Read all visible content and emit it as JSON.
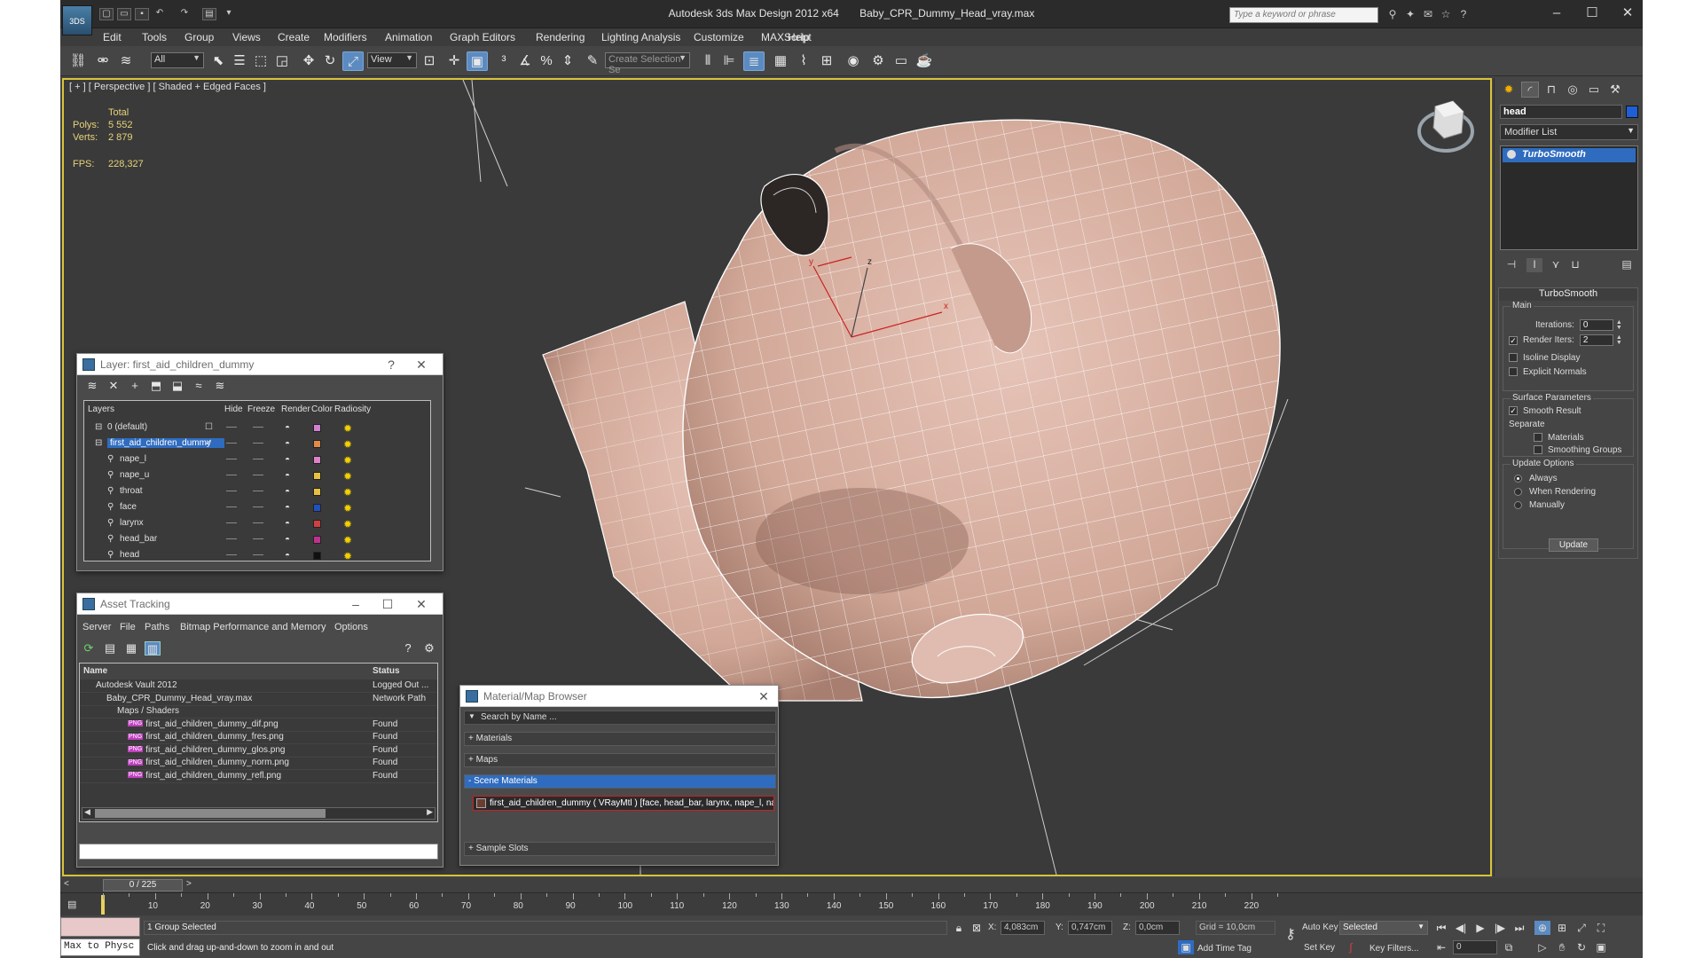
{
  "app": {
    "logo_text": "3DS",
    "title": "Autodesk 3ds Max Design 2012 x64       Baby_CPR_Dummy_Head_vray.max",
    "search_placeholder": "Type a keyword or phrase"
  },
  "menu": [
    "Edit",
    "Tools",
    "Group",
    "Views",
    "Create",
    "Modifiers",
    "Animation",
    "Graph Editors",
    "Rendering",
    "Lighting Analysis",
    "Customize",
    "MAXScript",
    "Help"
  ],
  "toolbar": {
    "filter_value": "All",
    "ref_coord_value": "View",
    "selection_set_placeholder": "Create Selection Se"
  },
  "viewport": {
    "label": "[ + ] [ Perspective ] [ Shaded + Edged Faces ]",
    "stats_total": "Total",
    "polys_label": "Polys:",
    "polys_value": "5 552",
    "verts_label": "Verts:",
    "verts_value": "2 879",
    "fps_label": "FPS:",
    "fps_value": "228,327",
    "axis_x": "x",
    "axis_y": "y",
    "axis_z": "z",
    "mesh_color": "#d8b0a4",
    "wire_color": "#ffffff",
    "frame_color": "#d8c43a"
  },
  "command_panel": {
    "object_name": "head",
    "object_color": "#1e5fd6",
    "modifier_list_label": "Modifier List",
    "stack_item": "TurboSmooth",
    "rollout_title": "TurboSmooth",
    "main_label": "Main",
    "iterations_label": "Iterations:",
    "iterations_value": "0",
    "render_iters_label": "Render Iters:",
    "render_iters_value": "2",
    "render_iters_checked": true,
    "isoline_label": "Isoline Display",
    "explicit_normals_label": "Explicit Normals",
    "surface_params_label": "Surface Parameters",
    "smooth_result_label": "Smooth Result",
    "separate_label": "Separate",
    "materials_label": "Materials",
    "smoothing_groups_label": "Smoothing Groups",
    "update_options_label": "Update Options",
    "always_label": "Always",
    "when_rendering_label": "When Rendering",
    "manually_label": "Manually",
    "update_button": "Update"
  },
  "layer_panel": {
    "title": "Layer: first_aid_children_dummy",
    "help": "?",
    "headers": {
      "layers": "Layers",
      "hide": "Hide",
      "freeze": "Freeze",
      "render": "Render",
      "color": "Color",
      "radiosity": "Radiosity"
    },
    "rows": [
      {
        "name": "0 (default)",
        "color": "#d080d0"
      },
      {
        "name": "first_aid_children_dummy",
        "color": "#e08a4a"
      },
      {
        "name": "nape_l",
        "color": "#e080c8"
      },
      {
        "name": "nape_u",
        "color": "#e8c040"
      },
      {
        "name": "throat",
        "color": "#e8c040"
      },
      {
        "name": "face",
        "color": "#2050c0"
      },
      {
        "name": "larynx",
        "color": "#d04040"
      },
      {
        "name": "head_bar",
        "color": "#c03090"
      },
      {
        "name": "head",
        "color": "#101010"
      }
    ]
  },
  "asset_panel": {
    "title": "Asset Tracking",
    "menu": [
      "Server",
      "File",
      "Paths",
      "Bitmap Performance and Memory",
      "Options"
    ],
    "col_name": "Name",
    "col_status": "Status",
    "png_tag": "PNG",
    "rows": [
      {
        "name": "Autodesk Vault 2012",
        "status": "Logged Out ..."
      },
      {
        "name": "Baby_CPR_Dummy_Head_vray.max",
        "status": "Network Path"
      },
      {
        "name": "Maps / Shaders",
        "status": ""
      },
      {
        "name": "first_aid_children_dummy_dif.png",
        "status": "Found"
      },
      {
        "name": "first_aid_children_dummy_fres.png",
        "status": "Found"
      },
      {
        "name": "first_aid_children_dummy_glos.png",
        "status": "Found"
      },
      {
        "name": "first_aid_children_dummy_norm.png",
        "status": "Found"
      },
      {
        "name": "first_aid_children_dummy_refl.png",
        "status": "Found"
      }
    ]
  },
  "material_browser": {
    "title": "Material/Map Browser",
    "search_placeholder": "Search by Name ...",
    "sec_materials": "+ Materials",
    "sec_maps": "+ Maps",
    "sec_scene": "- Scene Materials",
    "scene_material": "first_aid_children_dummy  ( VRayMtl )  [face, head_bar, larynx, nape_l, nape_u,...",
    "sec_samples": "+ Sample Slots"
  },
  "timeline": {
    "frame": "0 / 225",
    "ticks": [
      "10",
      "20",
      "30",
      "40",
      "50",
      "60",
      "70",
      "80",
      "90",
      "100",
      "110",
      "120",
      "130",
      "140",
      "150",
      "160",
      "170",
      "180",
      "190",
      "200",
      "210",
      "220"
    ]
  },
  "status": {
    "maxscript": "Max to Physc",
    "selected": "1 Group Selected",
    "prompt": "Click and drag up-and-down to zoom in and out",
    "x_label": "X:",
    "x_value": "4,083cm",
    "y_label": "Y:",
    "y_value": "0,747cm",
    "z_label": "Z:",
    "z_value": "0,0cm",
    "grid": "Grid = 10,0cm",
    "add_time_tag": "Add Time Tag",
    "auto_key": "Auto Key",
    "set_key": "Set Key",
    "selected_dropdown": "Selected",
    "key_filters": "Key Filters...",
    "current_frame": "0"
  }
}
